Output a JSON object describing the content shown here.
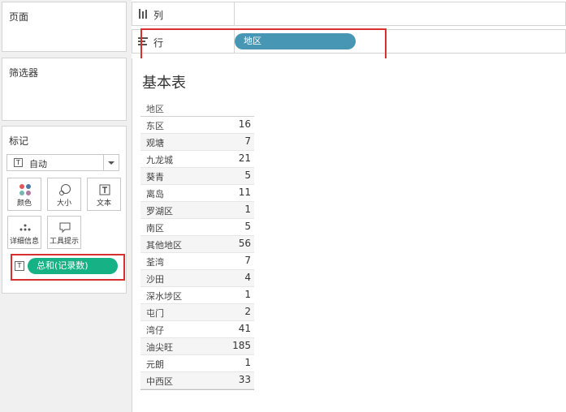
{
  "left_panels": {
    "pages_title": "页面",
    "filters_title": "筛选器",
    "marks_title": "标记"
  },
  "marks": {
    "type_selected": "自动",
    "buttons": [
      {
        "label": "颜色",
        "icon": "color-dots-icon"
      },
      {
        "label": "大小",
        "icon": "size-icon"
      },
      {
        "label": "文本",
        "icon": "text-icon"
      },
      {
        "label": "详细信息",
        "icon": "detail-icon"
      },
      {
        "label": "工具提示",
        "icon": "tooltip-icon"
      }
    ],
    "text_pill": "总和(记录数)",
    "text_pill_color": "#16b184"
  },
  "shelves": {
    "columns_label": "列",
    "rows_label": "行",
    "rows_pill": "地区",
    "rows_pill_color": "#4796b4"
  },
  "highlight_color": "#d83030",
  "view": {
    "title": "基本表",
    "header": "地区",
    "rows": [
      {
        "label": "东区",
        "value": "16"
      },
      {
        "label": "观塘",
        "value": "7"
      },
      {
        "label": "九龙城",
        "value": "21"
      },
      {
        "label": "葵青",
        "value": "5"
      },
      {
        "label": "离岛",
        "value": "11"
      },
      {
        "label": "罗湖区",
        "value": "1"
      },
      {
        "label": "南区",
        "value": "5"
      },
      {
        "label": "其他地区",
        "value": "56"
      },
      {
        "label": "荃湾",
        "value": "7"
      },
      {
        "label": "沙田",
        "value": "4"
      },
      {
        "label": "深水埗区",
        "value": "1"
      },
      {
        "label": "屯门",
        "value": "2"
      },
      {
        "label": "湾仔",
        "value": "41"
      },
      {
        "label": "油尖旺",
        "value": "185"
      },
      {
        "label": "元朗",
        "value": "1"
      },
      {
        "label": "中西区",
        "value": "33"
      }
    ]
  }
}
